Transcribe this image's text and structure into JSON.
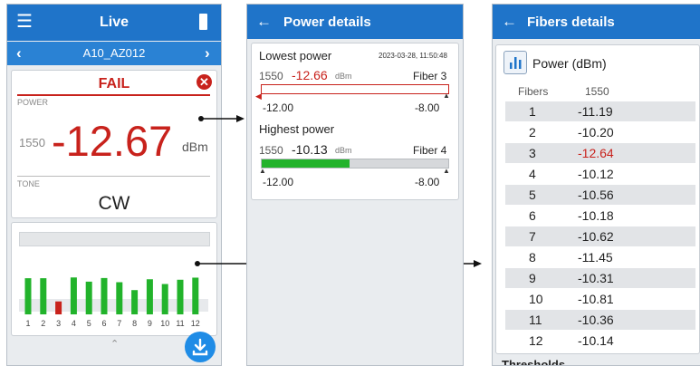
{
  "panel1": {
    "title": "Live",
    "subtitle": "A10_AZ012",
    "status": "FAIL",
    "power_label": "POWER",
    "wavelength": "1550",
    "power_value": "-12.67",
    "power_unit": "dBm",
    "tone_label": "TONE",
    "tone_value": "CW",
    "bar_labels": [
      "1",
      "2",
      "3",
      "4",
      "5",
      "6",
      "7",
      "8",
      "9",
      "10",
      "11",
      "12"
    ],
    "bar_values": [
      -10.2,
      -10.2,
      -12.64,
      -10.12,
      -10.56,
      -10.18,
      -10.62,
      -11.45,
      -10.31,
      -10.81,
      -10.36,
      -10.14
    ],
    "colors": {
      "pass": "#22b32b",
      "fail": "#c8221c",
      "accent": "#1f74c9"
    }
  },
  "panel2": {
    "title": "Power details",
    "lowest_title": "Lowest power",
    "timestamp": "2023-03-28, 11:50:48",
    "lowest_wavelength": "1550",
    "lowest_value": "-12.66",
    "lowest_unit": "dBm",
    "lowest_fiber": "Fiber 3",
    "lowest_min": "-12.00",
    "lowest_max": "-8.00",
    "highest_title": "Highest power",
    "highest_wavelength": "1550",
    "highest_value": "-10.13",
    "highest_unit": "dBm",
    "highest_fiber": "Fiber 4",
    "highest_min": "-12.00",
    "highest_max": "-8.00",
    "highest_fill_fraction": 0.47
  },
  "panel3": {
    "title": "Fibers details",
    "section_title": "Power (dBm)",
    "col_fibers": "Fibers",
    "col_wavelength": "1550",
    "rows": [
      {
        "fiber": "1",
        "value": "-11.19",
        "fail": false
      },
      {
        "fiber": "2",
        "value": "-10.20",
        "fail": false
      },
      {
        "fiber": "3",
        "value": "-12.64",
        "fail": true
      },
      {
        "fiber": "4",
        "value": "-10.12",
        "fail": false
      },
      {
        "fiber": "5",
        "value": "-10.56",
        "fail": false
      },
      {
        "fiber": "6",
        "value": "-10.18",
        "fail": false
      },
      {
        "fiber": "7",
        "value": "-10.62",
        "fail": false
      },
      {
        "fiber": "8",
        "value": "-11.45",
        "fail": false
      },
      {
        "fiber": "9",
        "value": "-10.31",
        "fail": false
      },
      {
        "fiber": "10",
        "value": "-10.81",
        "fail": false
      },
      {
        "fiber": "11",
        "value": "-10.36",
        "fail": false
      },
      {
        "fiber": "12",
        "value": "-10.14",
        "fail": false
      }
    ],
    "footer_text": "Thresholds"
  }
}
